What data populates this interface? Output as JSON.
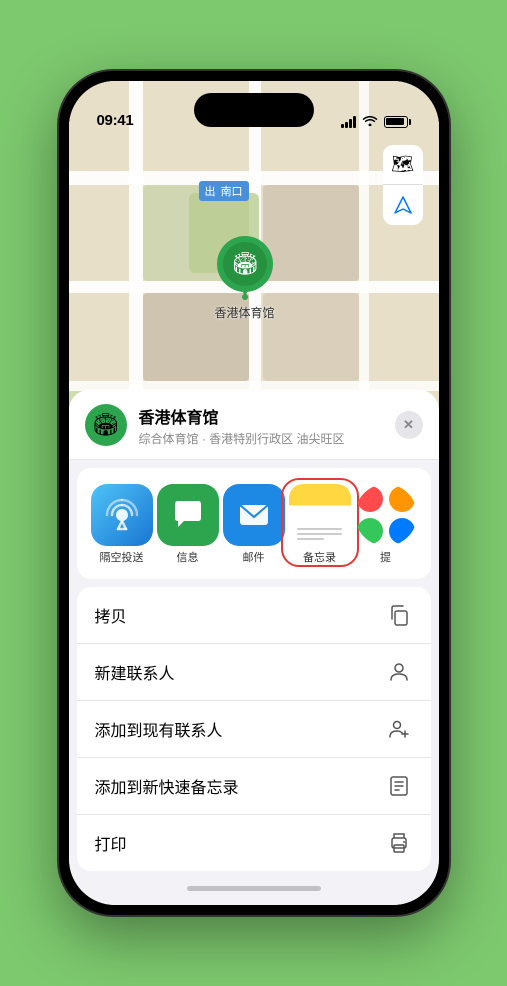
{
  "status_bar": {
    "time": "09:41",
    "signal_label": "signal",
    "wifi_label": "wifi",
    "battery_label": "battery"
  },
  "map": {
    "south_entrance_label": "南口",
    "stadium_name": "香港体育馆",
    "pin_emoji": "🏟️",
    "controls": {
      "map_type_icon": "🗺",
      "location_icon": "↗"
    }
  },
  "location_card": {
    "name": "香港体育馆",
    "description": "综合体育馆 · 香港特别行政区 油尖旺区",
    "icon_emoji": "🏟️",
    "close_label": "✕"
  },
  "share_items": [
    {
      "id": "airdrop",
      "label": "隔空投送",
      "emoji": "📡"
    },
    {
      "id": "message",
      "label": "信息",
      "emoji": "💬"
    },
    {
      "id": "mail",
      "label": "邮件",
      "emoji": "✉️"
    },
    {
      "id": "notes",
      "label": "备忘录",
      "emoji": ""
    },
    {
      "id": "more",
      "label": "提",
      "emoji": "⋯"
    }
  ],
  "action_items": [
    {
      "id": "copy",
      "label": "拷贝",
      "icon": "copy"
    },
    {
      "id": "new-contact",
      "label": "新建联系人",
      "icon": "person"
    },
    {
      "id": "add-existing",
      "label": "添加到现有联系人",
      "icon": "person-add"
    },
    {
      "id": "add-notes",
      "label": "添加到新快速备忘录",
      "icon": "notes"
    },
    {
      "id": "print",
      "label": "打印",
      "icon": "print"
    }
  ],
  "colors": {
    "green": "#2da44e",
    "blue": "#1e88e5",
    "red": "#e53935",
    "yellow": "#ffd740",
    "bg": "#f2f2f7"
  }
}
